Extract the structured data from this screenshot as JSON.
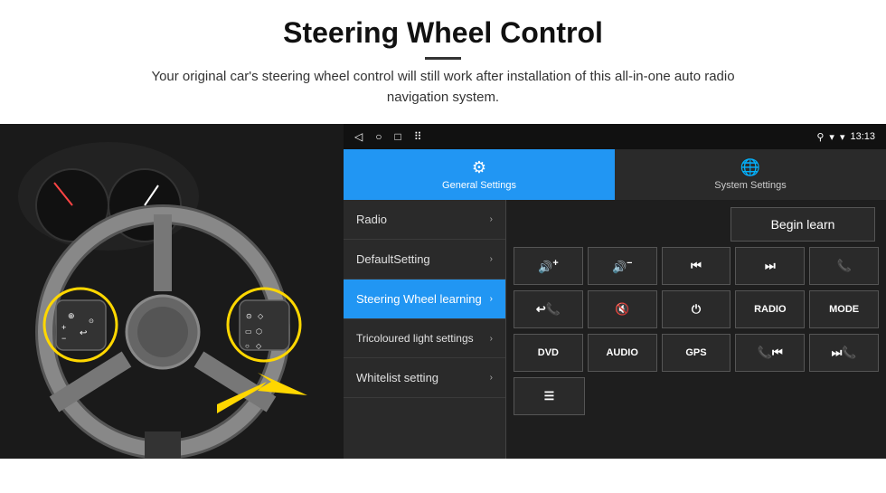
{
  "header": {
    "title": "Steering Wheel Control",
    "divider": true,
    "description": "Your original car's steering wheel control will still work after installation of this all-in-one auto radio navigation system."
  },
  "headunit": {
    "statusbar": {
      "time": "13:13",
      "nav_back": "◁",
      "nav_home": "○",
      "nav_square": "□",
      "nav_dots": "⠿"
    },
    "tabs": [
      {
        "label": "General Settings",
        "active": true
      },
      {
        "label": "System Settings",
        "active": false
      }
    ],
    "menu_items": [
      {
        "label": "Radio",
        "active": false
      },
      {
        "label": "DefaultSetting",
        "active": false
      },
      {
        "label": "Steering Wheel learning",
        "active": true
      },
      {
        "label": "Tricoloured light settings",
        "active": false
      },
      {
        "label": "Whitelist setting",
        "active": false
      }
    ],
    "begin_learn_label": "Begin learn",
    "control_buttons": [
      {
        "icon": "🔊+",
        "label": "vol up"
      },
      {
        "icon": "🔊−",
        "label": "vol down"
      },
      {
        "icon": "⏮",
        "label": "prev"
      },
      {
        "icon": "⏭",
        "label": "next"
      },
      {
        "icon": "📞",
        "label": "call"
      },
      {
        "icon": "📞↩",
        "label": "hang up"
      },
      {
        "icon": "🔇",
        "label": "mute"
      },
      {
        "icon": "⏻",
        "label": "power"
      },
      {
        "text": "RADIO",
        "label": "radio"
      },
      {
        "text": "MODE",
        "label": "mode"
      },
      {
        "text": "DVD",
        "label": "dvd"
      },
      {
        "text": "AUDIO",
        "label": "audio"
      },
      {
        "text": "GPS",
        "label": "gps"
      },
      {
        "icon": "📞⏮",
        "label": "tel prev"
      },
      {
        "icon": "⏩📞",
        "label": "tel next"
      }
    ],
    "bottom_button": {
      "icon": "🖹",
      "label": "list"
    }
  }
}
